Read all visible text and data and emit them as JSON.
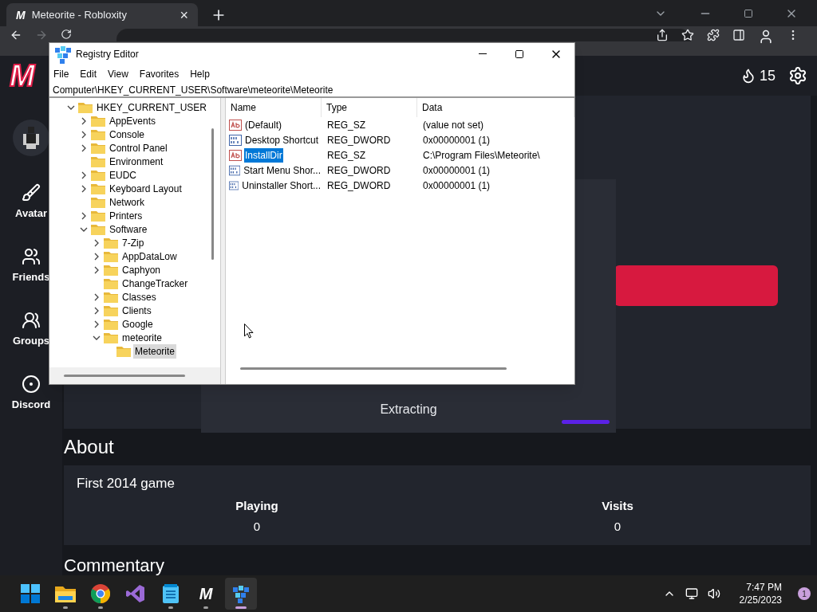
{
  "browser": {
    "tab": {
      "favicon": "M",
      "title": "Meteorite - Robloxity",
      "close": "×"
    }
  },
  "site": {
    "logo": "M",
    "streak": "15",
    "sidebar": [
      {
        "kind": "brush",
        "label": "Avatar"
      },
      {
        "kind": "friends",
        "label": "Friends"
      },
      {
        "kind": "groups",
        "label": "Groups"
      },
      {
        "kind": "discord",
        "label": "Discord"
      }
    ],
    "status": "Extracting",
    "about": {
      "heading": "About",
      "description": "First 2014 game",
      "stats": [
        {
          "label": "Playing",
          "value": "0"
        },
        {
          "label": "Visits",
          "value": "0"
        }
      ]
    },
    "next_heading": "Commentary"
  },
  "regedit": {
    "title": "Registry Editor",
    "menu": [
      "File",
      "Edit",
      "View",
      "Favorites",
      "Help"
    ],
    "address": "Computer\\HKEY_CURRENT_USER\\Software\\meteorite\\Meteorite",
    "tree": [
      {
        "label": "HKEY_CURRENT_USER",
        "expanded": true,
        "selected": false,
        "children": [
          {
            "label": "AppEvents",
            "expandable": true,
            "expanded": false,
            "selected": false
          },
          {
            "label": "Console",
            "expandable": true,
            "expanded": false,
            "selected": false
          },
          {
            "label": "Control Panel",
            "expandable": true,
            "expanded": false,
            "selected": false
          },
          {
            "label": "Environment",
            "expandable": false,
            "expanded": false,
            "selected": false
          },
          {
            "label": "EUDC",
            "expandable": true,
            "expanded": false,
            "selected": false
          },
          {
            "label": "Keyboard Layout",
            "expandable": true,
            "expanded": false,
            "selected": false
          },
          {
            "label": "Network",
            "expandable": false,
            "expanded": false,
            "selected": false
          },
          {
            "label": "Printers",
            "expandable": true,
            "expanded": false,
            "selected": false
          },
          {
            "label": "Software",
            "expanded": true,
            "selected": false,
            "children": [
              {
                "label": "7-Zip",
                "expandable": true,
                "expanded": false,
                "selected": false
              },
              {
                "label": "AppDataLow",
                "expandable": true,
                "expanded": false,
                "selected": false
              },
              {
                "label": "Caphyon",
                "expandable": true,
                "expanded": false,
                "selected": false
              },
              {
                "label": "ChangeTracker",
                "expandable": false,
                "expanded": false,
                "selected": false
              },
              {
                "label": "Classes",
                "expandable": true,
                "expanded": false,
                "selected": false
              },
              {
                "label": "Clients",
                "expandable": true,
                "expanded": false,
                "selected": false
              },
              {
                "label": "Google",
                "expandable": true,
                "expanded": false,
                "selected": false
              },
              {
                "label": "meteorite",
                "expanded": true,
                "selected": false,
                "children": [
                  {
                    "label": "Meteorite",
                    "expandable": false,
                    "expanded": false,
                    "selected": true
                  }
                ]
              }
            ]
          }
        ]
      }
    ],
    "columns": [
      "Name",
      "Type",
      "Data"
    ],
    "values": [
      {
        "kind": "string",
        "name": "(Default)",
        "type": "REG_SZ",
        "data": "(value not set)",
        "selected": false
      },
      {
        "kind": "binary",
        "name": "Desktop Shortcut",
        "type": "REG_DWORD",
        "data": "0x00000001 (1)",
        "selected": false
      },
      {
        "kind": "string",
        "name": "InstallDir",
        "type": "REG_SZ",
        "data": "C:\\Program Files\\Meteorite\\",
        "selected": true
      },
      {
        "kind": "binary",
        "name": "Start Menu Shor...",
        "type": "REG_DWORD",
        "data": "0x00000001 (1)",
        "selected": false
      },
      {
        "kind": "binary",
        "name": "Uninstaller Short...",
        "type": "REG_DWORD",
        "data": "0x00000001 (1)",
        "selected": false
      }
    ]
  },
  "taskbar": {
    "apps": [
      {
        "kind": "start",
        "running": false,
        "active": false
      },
      {
        "kind": "files",
        "running": true,
        "active": false
      },
      {
        "kind": "chrome",
        "running": true,
        "active": false
      },
      {
        "kind": "studio",
        "running": false,
        "active": false
      },
      {
        "kind": "notepad",
        "running": true,
        "active": false
      },
      {
        "kind": "meteorite",
        "running": true,
        "active": false
      },
      {
        "kind": "regedit",
        "running": true,
        "active": true
      }
    ],
    "meteorite_letter": "M",
    "time": "7:47 PM",
    "date": "2/25/2023",
    "notifications": "1"
  }
}
